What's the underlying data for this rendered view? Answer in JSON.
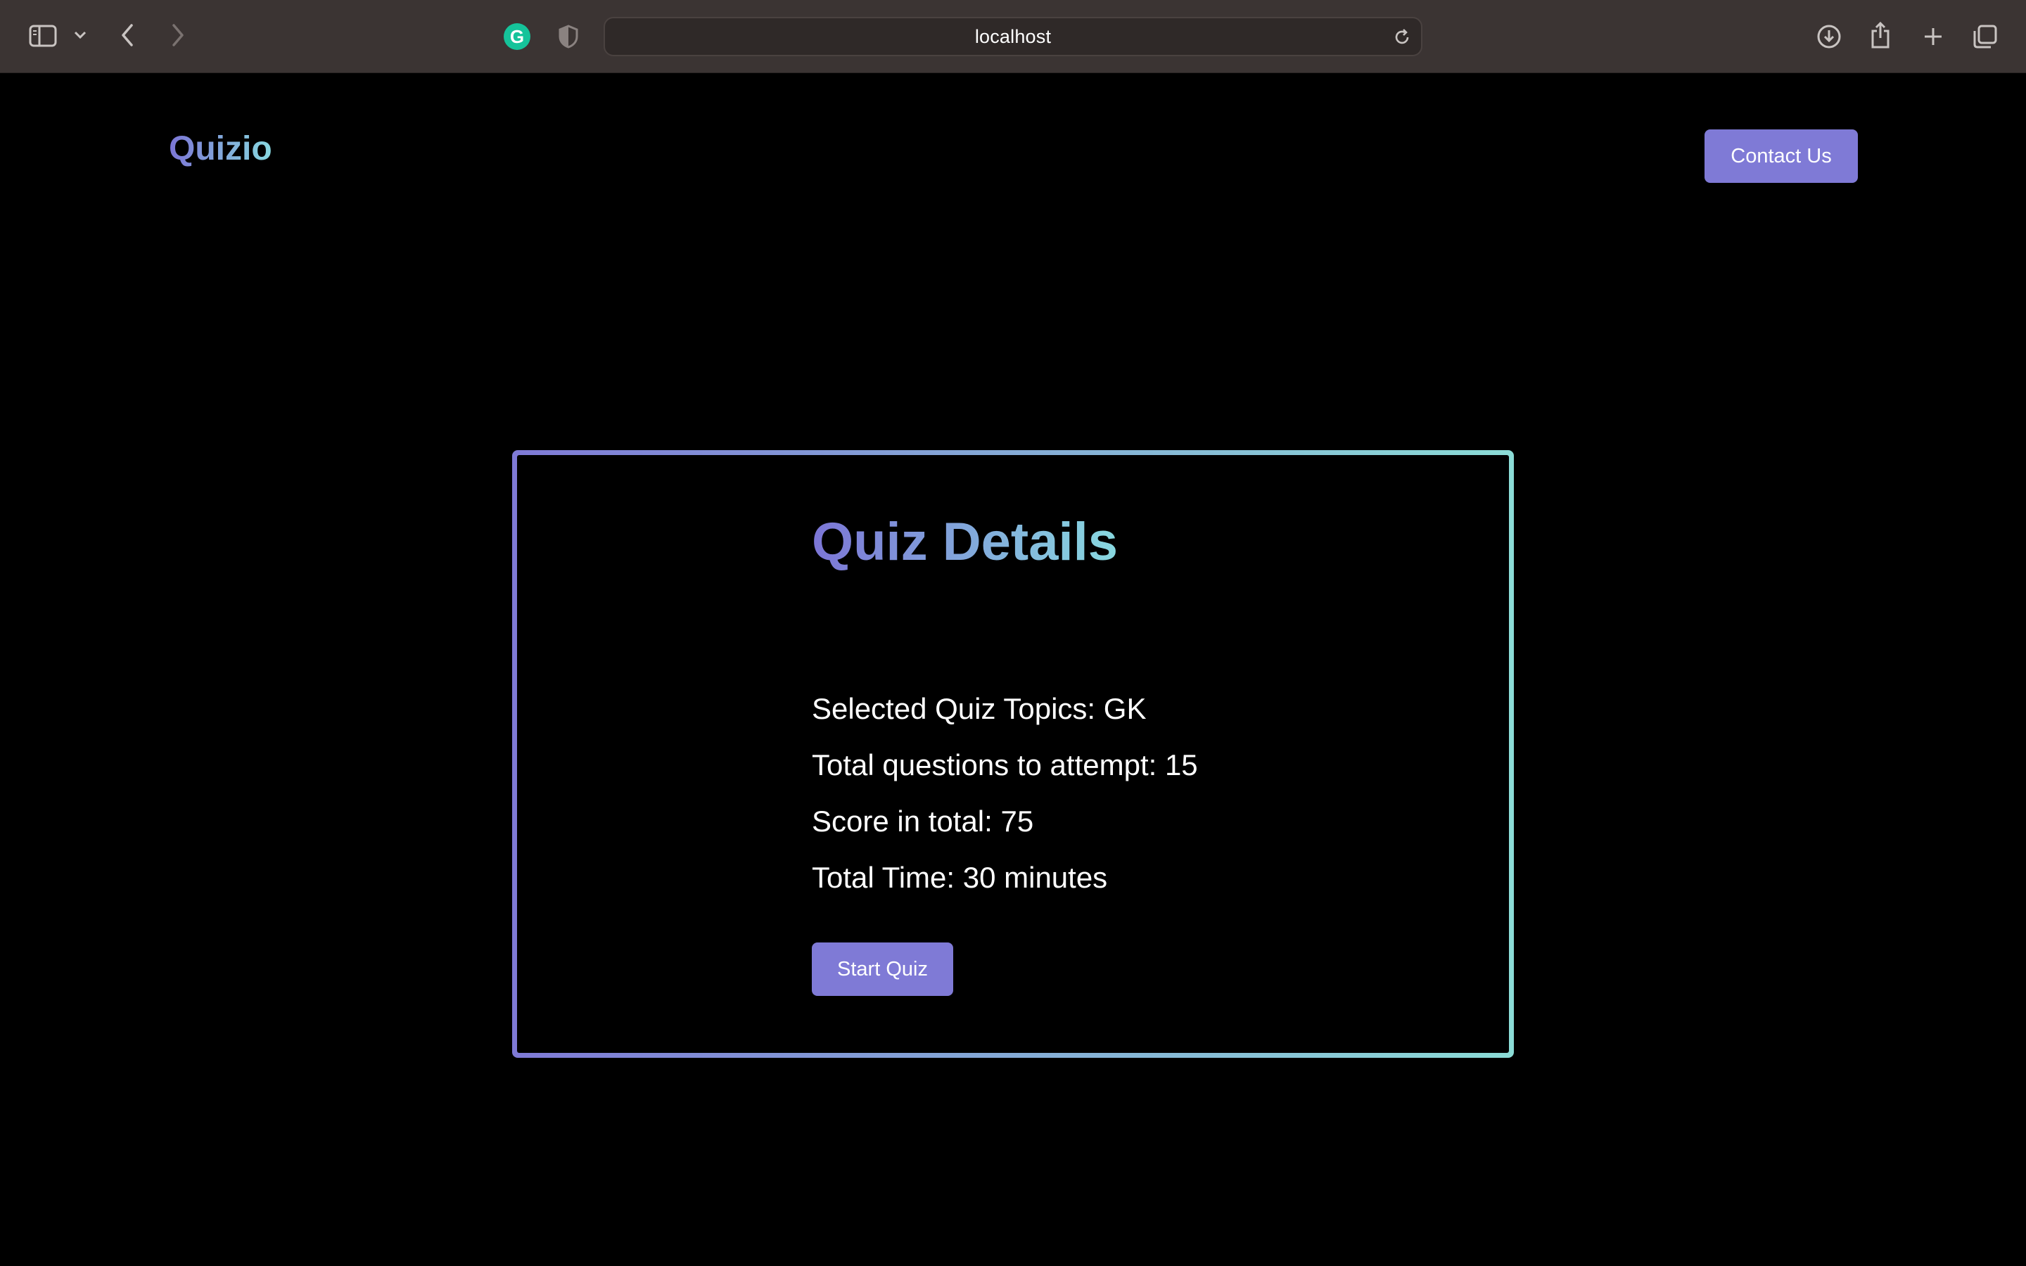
{
  "browser": {
    "url": "localhost",
    "icons": [
      "sidebar-icon",
      "chevron-down-icon",
      "back-icon",
      "forward-icon",
      "grammarly-icon",
      "privacy-shield-icon",
      "reload-icon",
      "download-icon",
      "share-icon",
      "new-tab-icon",
      "tab-overview-icon"
    ],
    "grammarly_letter": "G"
  },
  "header": {
    "logo": "Quizio",
    "contact_label": "Contact Us"
  },
  "quiz": {
    "title": "Quiz Details",
    "topics": "Selected Quiz Topics: GK",
    "questions": "Total questions to attempt: 15",
    "score": "Score in total: 75",
    "time": "Total Time: 30 minutes",
    "start_label": "Start Quiz"
  },
  "colors": {
    "accent": "#7f7ad6",
    "gradient_start": "#7c75d6",
    "gradient_end": "#88d9e0",
    "background": "#000000",
    "toolbar": "#3b3433"
  }
}
